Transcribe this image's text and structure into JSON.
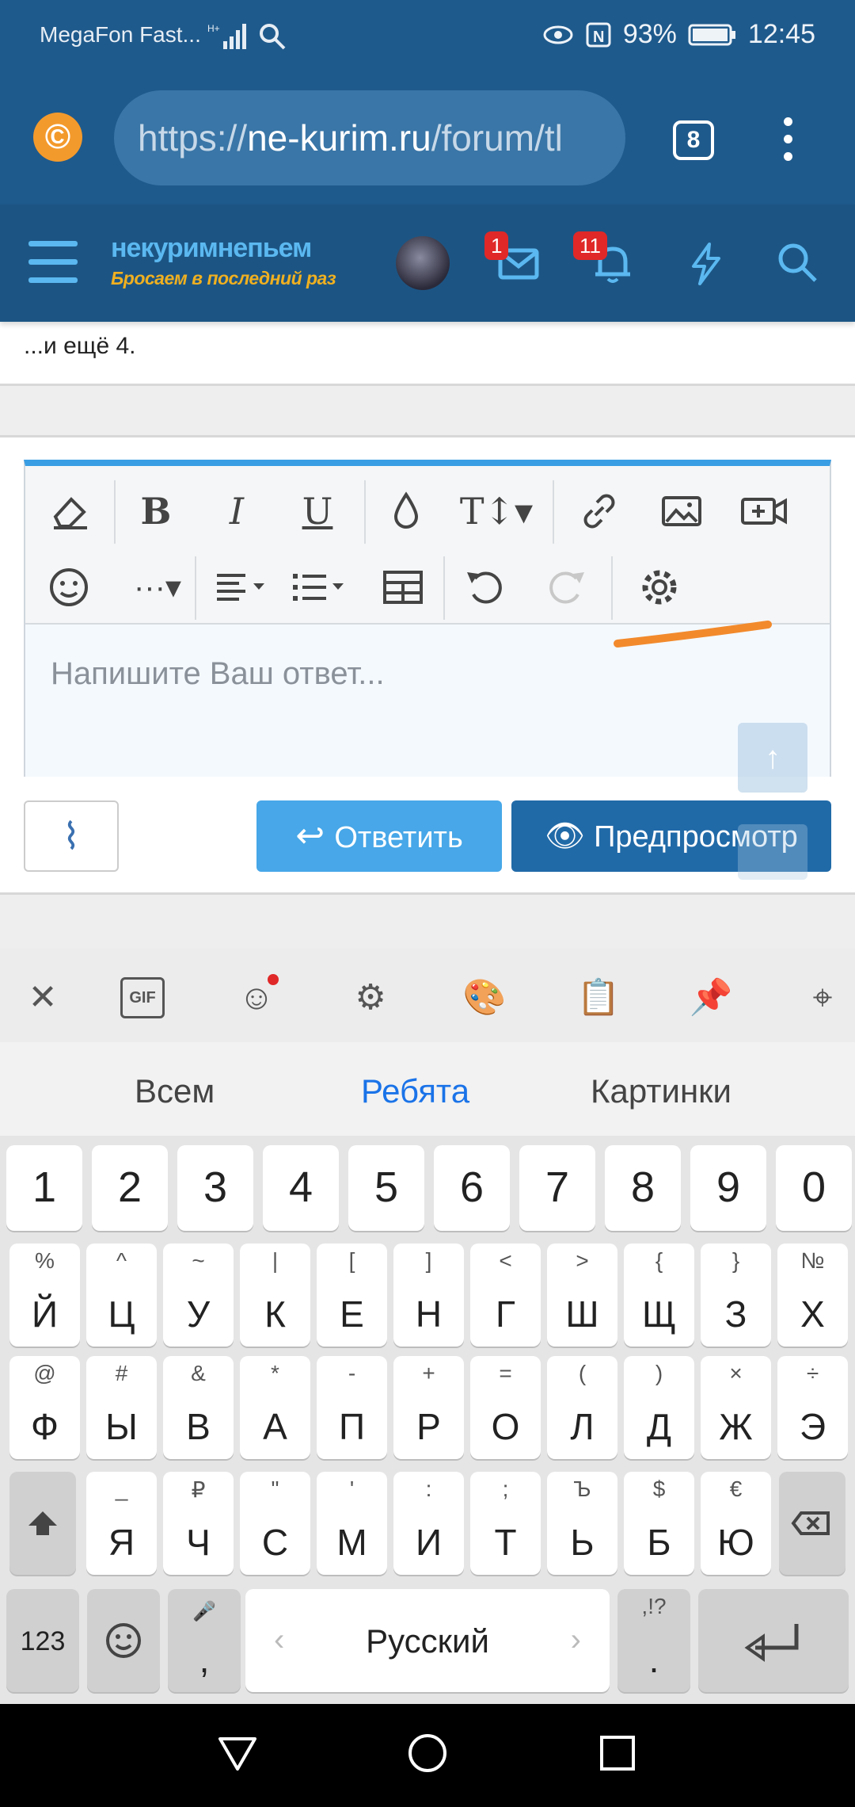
{
  "status_bar": {
    "carrier": "MegaFon Fast...",
    "battery": "93%",
    "time": "12:45"
  },
  "browser": {
    "url_scheme": "https://",
    "url_host": "ne-kurim.ru",
    "url_path": "/forum/tl",
    "tab_count": "8"
  },
  "site_header": {
    "logo_line1": "некуримнепьем",
    "logo_line2": "Бросаем в последний раз",
    "messages_badge": "1",
    "alerts_badge": "11"
  },
  "content": {
    "more_text": "...и ещё 4."
  },
  "editor": {
    "placeholder": "Напишите Ваш ответ..."
  },
  "buttons": {
    "reply": "Ответить",
    "preview": "Предпросмотр"
  },
  "keyboard": {
    "tool_gif": "GIF",
    "tabs": [
      "Всем",
      "Ребята",
      "Картинки"
    ],
    "active_tab_color": "#1a73e8",
    "numbers": [
      "1",
      "2",
      "3",
      "4",
      "5",
      "6",
      "7",
      "8",
      "9",
      "0"
    ],
    "row1": [
      {
        "s": "%",
        "m": "Й"
      },
      {
        "s": "^",
        "m": "Ц"
      },
      {
        "s": "~",
        "m": "У"
      },
      {
        "s": "|",
        "m": "К"
      },
      {
        "s": "[",
        "m": "Е"
      },
      {
        "s": "]",
        "m": "Н"
      },
      {
        "s": "<",
        "m": "Г"
      },
      {
        "s": ">",
        "m": "Ш"
      },
      {
        "s": "{",
        "m": "Щ"
      },
      {
        "s": "}",
        "m": "З"
      },
      {
        "s": "№",
        "m": "Х"
      }
    ],
    "row2": [
      {
        "s": "@",
        "m": "Ф"
      },
      {
        "s": "#",
        "m": "Ы"
      },
      {
        "s": "&",
        "m": "В"
      },
      {
        "s": "*",
        "m": "А"
      },
      {
        "s": "-",
        "m": "П"
      },
      {
        "s": "+",
        "m": "Р"
      },
      {
        "s": "=",
        "m": "О"
      },
      {
        "s": "(",
        "m": "Л"
      },
      {
        "s": ")",
        "m": "Д"
      },
      {
        "s": "×",
        "m": "Ж"
      },
      {
        "s": "÷",
        "m": "Э"
      }
    ],
    "row3": [
      {
        "s": "_",
        "m": "Я"
      },
      {
        "s": "₽",
        "m": "Ч"
      },
      {
        "s": "\"",
        "m": "С"
      },
      {
        "s": "'",
        "m": "М"
      },
      {
        "s": ":",
        "m": "И"
      },
      {
        "s": ";",
        "m": "Т"
      },
      {
        "s": "Ъ",
        "m": "Ь"
      },
      {
        "s": "$",
        "m": "Б"
      },
      {
        "s": "€",
        "m": "Ю"
      }
    ],
    "key_123": "123",
    "comma": ",",
    "space_label": "Русский",
    "period": ".",
    "period_alt": ",!?"
  }
}
